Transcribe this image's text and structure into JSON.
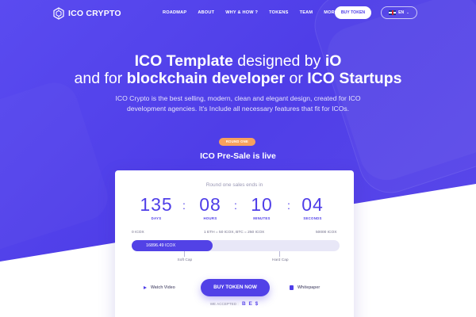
{
  "brand": {
    "name": "ICO CRYPTO",
    "logo_icon": "hexagon-cube-icon"
  },
  "nav": {
    "items": [
      {
        "label": "ROADMAP"
      },
      {
        "label": "ABOUT"
      },
      {
        "label": "WHY & HOW ?"
      },
      {
        "label": "TOKENS"
      },
      {
        "label": "TEAM"
      },
      {
        "label": "MORE"
      }
    ],
    "buy_label": "BUY TOKEN",
    "lang_label": "EN"
  },
  "hero": {
    "line1_bold": "ICO Template",
    "line1_light": " designed by ",
    "line1_bold2": "iO",
    "line2_light": "and for ",
    "line2_bold": "blockchain developer",
    "line2_light2": " or ",
    "line2_bold2": "ICO Startups",
    "subtitle": "ICO Crypto is the best selling, modern, clean and elegant design, created for ICO development agencies. It's Include all necessary features that fit for ICOs.",
    "round_badge": "ROUND ONE",
    "presale_title": "ICO Pre-Sale is live"
  },
  "countdown": {
    "caption": "Round one sales ends in",
    "days": "135",
    "days_label": "DAYS",
    "hours": "08",
    "hours_label": "HOURS",
    "minutes": "10",
    "minutes_label": "MINUTES",
    "seconds": "04",
    "seconds_label": "SECONDS"
  },
  "progress": {
    "start_label": "0 ICOX",
    "rate_label": "1 ETH = 50 ICOX, BTC = 250 ICOX",
    "end_label": "50000 ICOX",
    "raised_label": "16896.49 ICOX",
    "fill_fraction": 0.39,
    "soft_cap_label": "Soft Cap",
    "soft_cap_fraction": 0.25,
    "hard_cap_label": "Hard Cap",
    "hard_cap_fraction": 0.71
  },
  "actions": {
    "watch_label": "Watch Video",
    "buy_label": "BUY TOKEN NOW",
    "whitepaper_label": "Whitepaper",
    "accepted_label": "WE ACCEPTED :",
    "accepted_coins": "B E $"
  },
  "colors": {
    "primary": "#4f3ee8",
    "accent": "#f7a15d"
  }
}
